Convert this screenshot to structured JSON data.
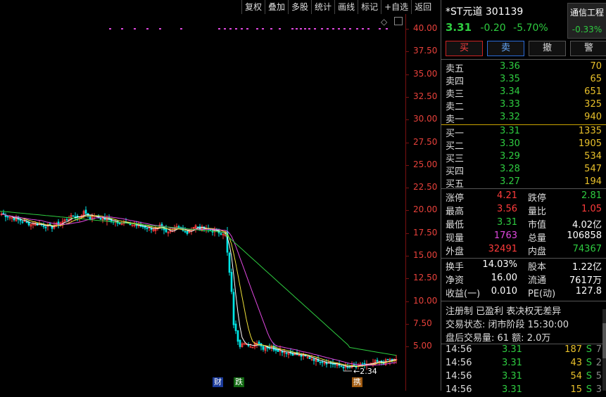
{
  "toolbar": {
    "items": [
      "复权",
      "叠加",
      "多股",
      "统计",
      "画线",
      "标记",
      "+自选",
      "返回"
    ]
  },
  "y_axis": {
    "ticks": [
      "40.00",
      "37.50",
      "35.00",
      "32.50",
      "30.00",
      "27.50",
      "25.00",
      "22.50",
      "20.00",
      "17.50",
      "15.00",
      "12.50",
      "10.00",
      "7.50",
      "5.00"
    ]
  },
  "chart": {
    "low_label": "←2.34",
    "events": [
      "财",
      "跌",
      "携"
    ],
    "colors": {
      "up": "#ff3b3b",
      "down": "#00e5e5",
      "ma5": "#ffffff",
      "ma10": "#f2e33a",
      "ma20": "#e048e0",
      "ma60": "#2ecc40",
      "axis": "#e8413b"
    }
  },
  "header": {
    "title": "*ST元道 301139",
    "price": "3.31",
    "change": "-0.20",
    "change_pct": "-5.70%",
    "industry_name": "通信工程",
    "industry_pct": "-0.33%"
  },
  "actions": {
    "buy": "买",
    "sell": "卖",
    "cancel": "撤",
    "alert": "警"
  },
  "asks": [
    {
      "label": "卖五",
      "price": "3.36",
      "vol": "70"
    },
    {
      "label": "卖四",
      "price": "3.35",
      "vol": "65"
    },
    {
      "label": "卖三",
      "price": "3.34",
      "vol": "651"
    },
    {
      "label": "卖二",
      "price": "3.33",
      "vol": "325"
    },
    {
      "label": "卖一",
      "price": "3.32",
      "vol": "940"
    }
  ],
  "bids": [
    {
      "label": "买一",
      "price": "3.31",
      "vol": "1335"
    },
    {
      "label": "买二",
      "price": "3.30",
      "vol": "1905"
    },
    {
      "label": "买三",
      "price": "3.29",
      "vol": "534"
    },
    {
      "label": "买四",
      "price": "3.28",
      "vol": "547"
    },
    {
      "label": "买五",
      "price": "3.27",
      "vol": "194"
    }
  ],
  "quote1": [
    {
      "l1": "涨停",
      "v1": "4.21",
      "c1": "red",
      "l2": "跌停",
      "v2": "2.81",
      "c2": "green"
    },
    {
      "l1": "最高",
      "v1": "3.56",
      "c1": "red",
      "l2": "量比",
      "v2": "1.05",
      "c2": "red"
    },
    {
      "l1": "最低",
      "v1": "3.31",
      "c1": "green",
      "l2": "市值",
      "v2": "4.02亿",
      "c2": "white"
    },
    {
      "l1": "现量",
      "v1": "1763",
      "c1": "magenta",
      "l2": "总量",
      "v2": "106858",
      "c2": "white"
    },
    {
      "l1": "外盘",
      "v1": "32491",
      "c1": "red",
      "l2": "内盘",
      "v2": "74367",
      "c2": "green"
    }
  ],
  "quote2": [
    {
      "l1": "换手",
      "v1": "14.03%",
      "c1": "white",
      "l2": "股本",
      "v2": "1.22亿",
      "c2": "white"
    },
    {
      "l1": "净资",
      "v1": "16.00",
      "c1": "white",
      "l2": "流通",
      "v2": "7617万",
      "c2": "white"
    },
    {
      "l1": "收益(一)",
      "v1": "0.010",
      "c1": "white",
      "l2": "PE(动)",
      "v2": "127.8",
      "c2": "white"
    }
  ],
  "info": {
    "tags": "注册制 已盈利 表决权无差异",
    "status": "交易状态: 闭市阶段 15:30:00",
    "after_hours": "盘后交易量: 61  额: 2.0万"
  },
  "ticks": [
    {
      "time": "14:56",
      "price": "3.31",
      "vol": "187",
      "side": "S",
      "n": "7"
    },
    {
      "time": "14:56",
      "price": "3.31",
      "vol": "43",
      "side": "S",
      "n": "2"
    },
    {
      "time": "14:56",
      "price": "3.31",
      "vol": "54",
      "side": "S",
      "n": "5"
    },
    {
      "time": "14:56",
      "price": "3.31",
      "vol": "15",
      "side": "S",
      "n": "3"
    }
  ]
}
